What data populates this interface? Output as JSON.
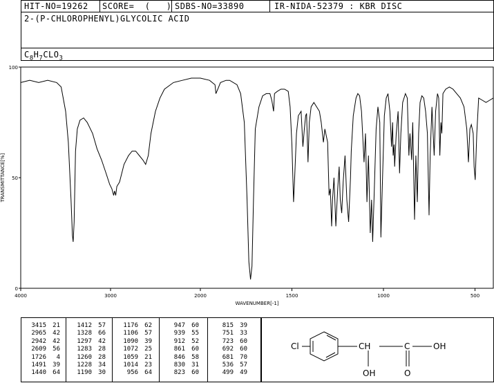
{
  "header": {
    "hit_no": "HIT-NO=19262",
    "score": "SCORE=  (   )",
    "sdbs_no": "SDBS-NO=33890",
    "ir_info": "IR-NIDA-52379 : KBR DISC",
    "compound_name": "2-(P-CHLOROPHENYL)GLYCOLIC ACID",
    "formula_main": "C",
    "formula_sub1": "8",
    "formula_h": "H",
    "formula_sub2": "7",
    "formula_clo": "CLO",
    "formula_sub3": "3"
  },
  "chart_data": {
    "type": "line",
    "title": "",
    "xlabel": "WAVENUMBER[-1]",
    "ylabel": "TRANSMITTANCE[%]",
    "xlim": [
      4000,
      400
    ],
    "ylim": [
      0,
      100
    ],
    "x_ticks": [
      "4000",
      "3000",
      "2000",
      "1500",
      "1000",
      "500"
    ],
    "y_ticks": [
      "100",
      "50",
      "0"
    ],
    "series": [
      {
        "points": [
          [
            4000,
            93
          ],
          [
            3900,
            94
          ],
          [
            3800,
            93
          ],
          [
            3700,
            94
          ],
          [
            3600,
            93
          ],
          [
            3550,
            91
          ],
          [
            3500,
            80
          ],
          [
            3470,
            66
          ],
          [
            3440,
            40
          ],
          [
            3425,
            24
          ],
          [
            3416,
            21
          ],
          [
            3405,
            30
          ],
          [
            3390,
            62
          ],
          [
            3370,
            72
          ],
          [
            3340,
            76
          ],
          [
            3300,
            77
          ],
          [
            3260,
            75
          ],
          [
            3200,
            70
          ],
          [
            3150,
            63
          ],
          [
            3100,
            58
          ],
          [
            3050,
            52
          ],
          [
            3010,
            47
          ],
          [
            2985,
            45
          ],
          [
            2965,
            42
          ],
          [
            2955,
            44
          ],
          [
            2942,
            42
          ],
          [
            2930,
            46
          ],
          [
            2900,
            48
          ],
          [
            2850,
            56
          ],
          [
            2800,
            60
          ],
          [
            2760,
            62
          ],
          [
            2720,
            62
          ],
          [
            2680,
            60
          ],
          [
            2640,
            58
          ],
          [
            2609,
            56
          ],
          [
            2580,
            60
          ],
          [
            2550,
            70
          ],
          [
            2500,
            80
          ],
          [
            2450,
            86
          ],
          [
            2400,
            90
          ],
          [
            2300,
            93
          ],
          [
            2200,
            94
          ],
          [
            2100,
            95
          ],
          [
            2000,
            95
          ],
          [
            1950,
            94
          ],
          [
            1920,
            92
          ],
          [
            1915,
            88
          ],
          [
            1905,
            90
          ],
          [
            1890,
            93
          ],
          [
            1860,
            94
          ],
          [
            1840,
            94
          ],
          [
            1800,
            92
          ],
          [
            1780,
            88
          ],
          [
            1760,
            75
          ],
          [
            1745,
            40
          ],
          [
            1735,
            12
          ],
          [
            1726,
            4
          ],
          [
            1718,
            10
          ],
          [
            1710,
            40
          ],
          [
            1700,
            72
          ],
          [
            1680,
            82
          ],
          [
            1660,
            87
          ],
          [
            1640,
            88
          ],
          [
            1620,
            88
          ],
          [
            1610,
            85
          ],
          [
            1600,
            80
          ],
          [
            1595,
            88
          ],
          [
            1580,
            89
          ],
          [
            1560,
            90
          ],
          [
            1540,
            90
          ],
          [
            1520,
            89
          ],
          [
            1510,
            82
          ],
          [
            1500,
            65
          ],
          [
            1491,
            39
          ],
          [
            1485,
            50
          ],
          [
            1475,
            70
          ],
          [
            1465,
            78
          ],
          [
            1450,
            80
          ],
          [
            1440,
            64
          ],
          [
            1432,
            72
          ],
          [
            1425,
            78
          ],
          [
            1420,
            79
          ],
          [
            1412,
            57
          ],
          [
            1405,
            75
          ],
          [
            1395,
            82
          ],
          [
            1380,
            84
          ],
          [
            1365,
            82
          ],
          [
            1350,
            80
          ],
          [
            1340,
            75
          ],
          [
            1328,
            66
          ],
          [
            1320,
            72
          ],
          [
            1305,
            66
          ],
          [
            1297,
            42
          ],
          [
            1290,
            45
          ],
          [
            1283,
            28
          ],
          [
            1278,
            40
          ],
          [
            1270,
            50
          ],
          [
            1260,
            28
          ],
          [
            1250,
            45
          ],
          [
            1242,
            55
          ],
          [
            1236,
            40
          ],
          [
            1228,
            34
          ],
          [
            1220,
            48
          ],
          [
            1210,
            60
          ],
          [
            1200,
            40
          ],
          [
            1190,
            30
          ],
          [
            1180,
            50
          ],
          [
            1176,
            62
          ],
          [
            1165,
            78
          ],
          [
            1150,
            86
          ],
          [
            1140,
            88
          ],
          [
            1130,
            87
          ],
          [
            1120,
            80
          ],
          [
            1106,
            57
          ],
          [
            1098,
            70
          ],
          [
            1090,
            39
          ],
          [
            1082,
            60
          ],
          [
            1072,
            25
          ],
          [
            1065,
            40
          ],
          [
            1059,
            21
          ],
          [
            1050,
            45
          ],
          [
            1040,
            72
          ],
          [
            1030,
            82
          ],
          [
            1020,
            75
          ],
          [
            1014,
            23
          ],
          [
            1005,
            50
          ],
          [
            995,
            78
          ],
          [
            985,
            86
          ],
          [
            975,
            88
          ],
          [
            965,
            80
          ],
          [
            956,
            64
          ],
          [
            950,
            75
          ],
          [
            947,
            60
          ],
          [
            942,
            65
          ],
          [
            939,
            55
          ],
          [
            930,
            70
          ],
          [
            920,
            80
          ],
          [
            912,
            52
          ],
          [
            905,
            70
          ],
          [
            895,
            84
          ],
          [
            880,
            88
          ],
          [
            870,
            86
          ],
          [
            861,
            60
          ],
          [
            855,
            70
          ],
          [
            846,
            58
          ],
          [
            840,
            75
          ],
          [
            830,
            31
          ],
          [
            823,
            60
          ],
          [
            815,
            39
          ],
          [
            808,
            70
          ],
          [
            800,
            84
          ],
          [
            790,
            87
          ],
          [
            780,
            86
          ],
          [
            770,
            80
          ],
          [
            760,
            70
          ],
          [
            751,
            33
          ],
          [
            745,
            60
          ],
          [
            735,
            82
          ],
          [
            723,
            60
          ],
          [
            715,
            80
          ],
          [
            705,
            88
          ],
          [
            698,
            86
          ],
          [
            692,
            60
          ],
          [
            686,
            75
          ],
          [
            681,
            70
          ],
          [
            675,
            88
          ],
          [
            660,
            90
          ],
          [
            640,
            91
          ],
          [
            620,
            90
          ],
          [
            600,
            88
          ],
          [
            580,
            86
          ],
          [
            560,
            82
          ],
          [
            545,
            72
          ],
          [
            536,
            57
          ],
          [
            528,
            72
          ],
          [
            520,
            74
          ],
          [
            510,
            70
          ],
          [
            505,
            55
          ],
          [
            499,
            49
          ],
          [
            490,
            70
          ],
          [
            480,
            86
          ],
          [
            460,
            85
          ],
          [
            440,
            84
          ],
          [
            420,
            85
          ],
          [
            400,
            86
          ]
        ]
      }
    ]
  },
  "peak_table": [
    [
      [
        "3415",
        "21"
      ],
      [
        "2965",
        "42"
      ],
      [
        "2942",
        "42"
      ],
      [
        "2609",
        "56"
      ],
      [
        "1726",
        "4"
      ],
      [
        "1491",
        "39"
      ],
      [
        "1440",
        "64"
      ]
    ],
    [
      [
        "1412",
        "57"
      ],
      [
        "1328",
        "66"
      ],
      [
        "1297",
        "42"
      ],
      [
        "1283",
        "28"
      ],
      [
        "1260",
        "28"
      ],
      [
        "1228",
        "34"
      ],
      [
        "1190",
        "30"
      ]
    ],
    [
      [
        "1176",
        "62"
      ],
      [
        "1106",
        "57"
      ],
      [
        "1090",
        "39"
      ],
      [
        "1072",
        "25"
      ],
      [
        "1059",
        "21"
      ],
      [
        "1014",
        "23"
      ],
      [
        "956",
        "64"
      ]
    ],
    [
      [
        "947",
        "60"
      ],
      [
        "939",
        "55"
      ],
      [
        "912",
        "52"
      ],
      [
        "861",
        "60"
      ],
      [
        "846",
        "58"
      ],
      [
        "830",
        "31"
      ],
      [
        "823",
        "60"
      ]
    ],
    [
      [
        "815",
        "39"
      ],
      [
        "751",
        "33"
      ],
      [
        "723",
        "60"
      ],
      [
        "692",
        "60"
      ],
      [
        "681",
        "70"
      ],
      [
        "536",
        "57"
      ],
      [
        "499",
        "49"
      ]
    ]
  ],
  "structure": {
    "cl_label": "Cl",
    "ch_label": "CH",
    "c_label": "C",
    "oh_label": "OH",
    "oh_bottom_label": "OH",
    "o_label": "O"
  }
}
